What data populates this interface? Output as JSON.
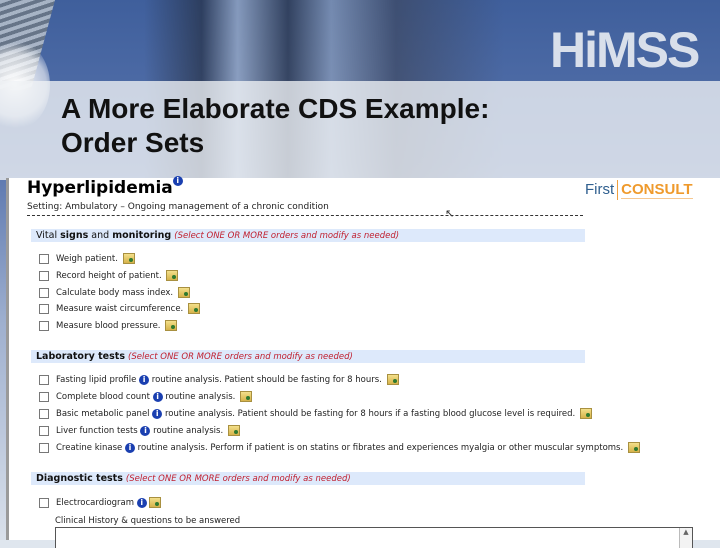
{
  "slide": {
    "logo": "HiMSS",
    "title_line1": "A More Elaborate CDS Example:",
    "title_line2": "Order Sets"
  },
  "cds": {
    "title": "Hyperlipidemia",
    "info_icon": "info-icon",
    "brand_first": "First",
    "brand_consult": "CONSULT",
    "setting": "Setting: Ambulatory – Ongoing management of a chronic condition",
    "sections": [
      {
        "name_plain1": "Vital ",
        "name_bold1": "signs",
        "name_plain2": " and ",
        "name_bold2": "monitoring",
        "hint": "(Select ONE OR MORE orders and modify as needed)",
        "items": [
          {
            "label": "Weigh patient.",
            "checked": false
          },
          {
            "label": "Record height of patient.",
            "checked": false
          },
          {
            "label": "Calculate body mass index.",
            "checked": false
          },
          {
            "label": "Measure waist circumference.",
            "checked": false
          },
          {
            "label": "Measure blood pressure.",
            "checked": false
          }
        ]
      },
      {
        "name": "Laboratory tests",
        "hint": "(Select ONE OR MORE orders and modify as needed)",
        "items": [
          {
            "label": "Fasting lipid profile",
            "detail": "routine analysis. Patient should be fasting for 8 hours.",
            "checked": false
          },
          {
            "label": "Complete blood count",
            "detail": "routine analysis.",
            "checked": false
          },
          {
            "label": "Basic metabolic panel",
            "detail": "routine analysis. Patient should be fasting for 8 hours if a fasting blood glucose level is required.",
            "checked": false
          },
          {
            "label": "Liver function tests",
            "detail": "routine analysis.",
            "checked": false
          },
          {
            "label": "Creatine kinase",
            "detail": "routine analysis. Perform if patient is on statins or fibrates and experiences myalgia or other muscular symptoms.",
            "checked": false
          }
        ]
      },
      {
        "name": "Diagnostic tests",
        "hint": "(Select ONE OR MORE orders and modify as needed)",
        "items": [
          {
            "label": "Electrocardiogram",
            "checked": false
          }
        ],
        "field_label": "Clinical History & questions to be answered",
        "field_value": ""
      }
    ]
  }
}
